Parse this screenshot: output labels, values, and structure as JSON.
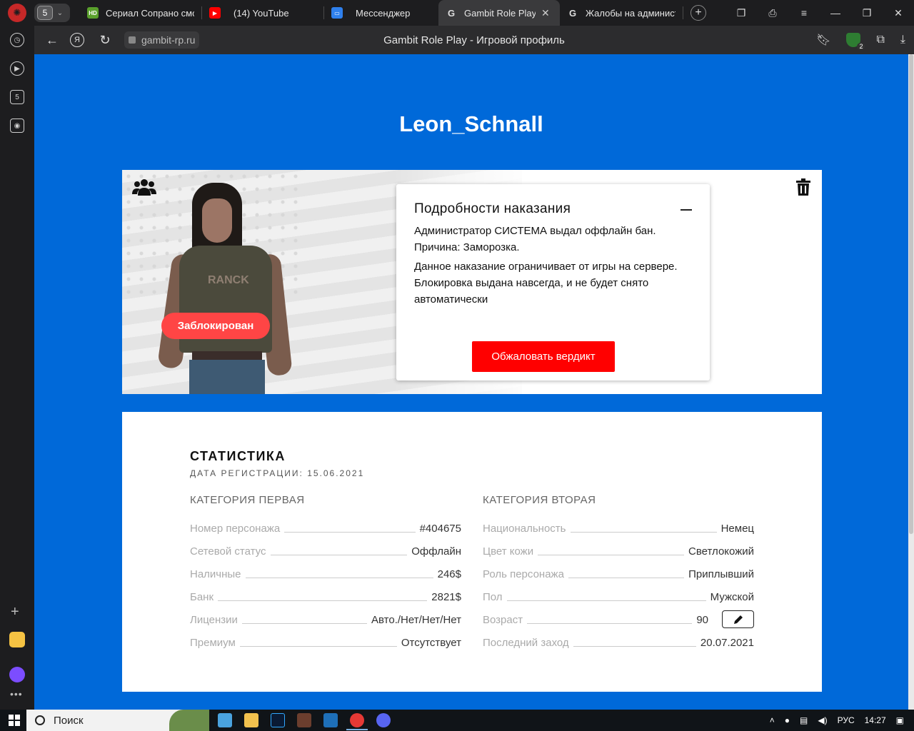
{
  "browser": {
    "tab_count": "5",
    "tabs": [
      {
        "label": "Сериал Сопрано смотреть онлайн",
        "favicon_text": "HD",
        "favicon_color": "#5aa02c"
      },
      {
        "label": "(14) YouTube",
        "favicon_text": "",
        "favicon_color": "#ff0000"
      },
      {
        "label": "Мессенджер",
        "favicon_text": "",
        "favicon_color": "#2f80ed"
      },
      {
        "label": "Gambit Role Play - Игровой профиль",
        "favicon_text": "G",
        "favicon_color": "#3a3a3c"
      },
      {
        "label": "Жалобы на администрацию",
        "favicon_text": "G",
        "favicon_color": "#1d1d1f"
      }
    ],
    "address": "gambit-rp.ru",
    "page_title": "Gambit Role Play - Игровой профиль",
    "ya_label": "Я",
    "extension_badge": "2",
    "sidebar_tab_count": "5"
  },
  "profile": {
    "player_name": "Leon_Schnall",
    "status_badge": "Заблокирован",
    "shirt_text": "RANCK",
    "punishment": {
      "title": "Подробности наказания",
      "line1": "Администратор СИСТЕМА выдал оффлайн бан.",
      "line2": "Причина: Заморозка.",
      "description": "Данное наказание ограничивает от игры на сервере. Блокировка выдана навсегда, и не будет снято автоматически",
      "appeal_button": "Обжаловать вердикт"
    }
  },
  "stats": {
    "title": "СТАТИСТИКА",
    "registration": "ДАТА РЕГИСТРАЦИИ: 15.06.2021",
    "category1": {
      "title": "КАТЕГОРИЯ ПЕРВАЯ",
      "rows": [
        {
          "label": "Номер персонажа",
          "value": "#404675"
        },
        {
          "label": "Сетевой статус",
          "value": "Оффлайн"
        },
        {
          "label": "Наличные",
          "value": "246$"
        },
        {
          "label": "Банк",
          "value": "2821$"
        },
        {
          "label": "Лицензии",
          "value": "Авто./Нет/Нет/Нет"
        },
        {
          "label": "Премиум",
          "value": "Отсутствует"
        }
      ]
    },
    "category2": {
      "title": "КАТЕГОРИЯ ВТОРАЯ",
      "rows": [
        {
          "label": "Национальность",
          "value": "Немец"
        },
        {
          "label": "Цвет кожи",
          "value": "Светлокожий"
        },
        {
          "label": "Роль персонажа",
          "value": "Приплывший"
        },
        {
          "label": "Пол",
          "value": "Мужской"
        },
        {
          "label": "Возраст",
          "value": "90"
        },
        {
          "label": "Последний заход",
          "value": "20.07.2021"
        }
      ]
    }
  },
  "taskbar": {
    "search_label": "Поиск",
    "language": "РУС",
    "time": "14:27"
  },
  "colors": {
    "page_bg": "#0069d9",
    "danger": "#ff0000",
    "badge": "#ff4545"
  }
}
